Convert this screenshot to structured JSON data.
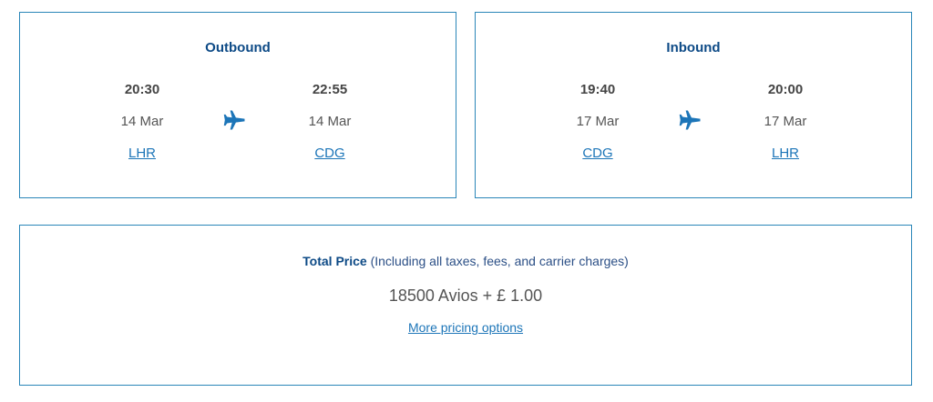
{
  "outbound": {
    "title": "Outbound",
    "depart_time": "20:30",
    "depart_date": "14 Mar",
    "depart_airport": "LHR",
    "arrive_time": "22:55",
    "arrive_date": "14 Mar",
    "arrive_airport": "CDG",
    "icon": "airplane-icon"
  },
  "inbound": {
    "title": "Inbound",
    "depart_time": "19:40",
    "depart_date": "17 Mar",
    "depart_airport": "CDG",
    "arrive_time": "20:00",
    "arrive_date": "17 Mar",
    "arrive_airport": "LHR",
    "icon": "airplane-icon"
  },
  "price": {
    "label": "Total Price",
    "note": "(Including all taxes, fees, and carrier charges)",
    "value": "18500 Avios + £ 1.00",
    "more_link": "More pricing options"
  },
  "colors": {
    "border": "#2a86b8",
    "heading": "#0d4a86",
    "link": "#1c75b8"
  }
}
